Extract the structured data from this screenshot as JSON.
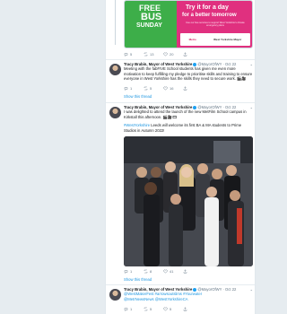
{
  "ad": {
    "free_line": "FREE",
    "bus_line": "BUS",
    "sunday_line": "SUNDAY",
    "headline_1": "Try it for a day",
    "headline_2": "for a better tomorrow",
    "fine_print": "Use our free services to support West Yorkshire's climate emergency plans",
    "sponsor_1": "Metro",
    "sponsor_2": "West Yorkshire Mayor"
  },
  "tweets": [
    {
      "actions": {
        "reply": "5",
        "retweet": "13",
        "like": "20"
      }
    },
    {
      "name": "Tracy Brabin, Mayor of West Yorkshire",
      "handle": "@MayorOfWY · Oct 22",
      "text": "Meeting with the fabFIVE School students has given me even more motivation to keep fulfilling my pledge to prioritise skills and training to ensure everyone in West Yorkshire has the skills they need to secure work. 🎬🎥",
      "actions": {
        "reply": "1",
        "retweet": "5",
        "like": "16"
      },
      "show_thread": "Show this thread"
    },
    {
      "name": "Tracy Brabin, Mayor of West Yorkshire",
      "handle": "@MayorOfWY · Oct 22",
      "text": "I was delighted to attend the launch of the new MetFilm School campus in Kirkstall this afternoon. 🎬🎥🎞",
      "text2_link": "#WestYorkshire",
      "text2": " Leeds will welcome its first BA & MA students to Prime Studios in Autumn 2022!",
      "actions": {
        "reply": "1",
        "retweet": "8",
        "like": "41"
      },
      "show_thread": "Show this thread"
    },
    {
      "name": "Tracy Brabin, Mayor of West Yorkshire",
      "handle": "@MayorOfWY · Oct 22",
      "text_link": "@WestMakerFest #arrowsoutslims #Yourwater @MetrNewsNews @WestYorkshireCA",
      "actions": {
        "reply": "1",
        "retweet": "5",
        "like": "5"
      }
    }
  ]
}
